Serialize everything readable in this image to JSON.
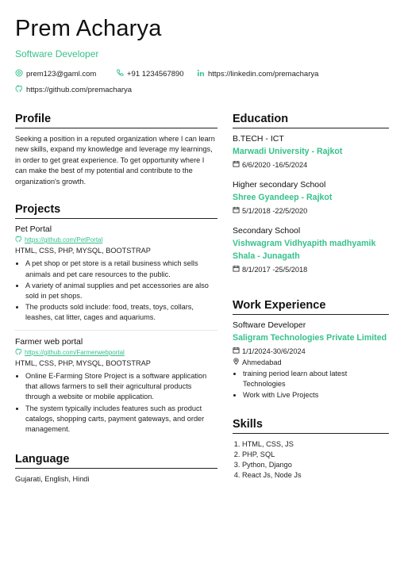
{
  "header": {
    "name": "Prem Acharya",
    "role": "Software Developer",
    "email": "prem123@gaml.com",
    "phone": "+91 1234567890",
    "linkedin": "https://linkedin.com/premacharya",
    "github": "https://github.com/premacharya"
  },
  "profile": {
    "heading": "Profile",
    "text": "Seeking a position in a reputed organization where I can learn new skills, expand my knowledge and leverage my learnings, in order to get great experience. To get opportunity where I can make the best of my potential and contribute to the organization's growth."
  },
  "projects": {
    "heading": "Projects",
    "items": [
      {
        "title": "Pet Portal",
        "link": "https://github.com/PetPortal",
        "tech": "HTML, CSS, PHP, MYSQL, BOOTSTRAP",
        "bullets": [
          "A pet shop or pet store is a retail business which sells animals and pet care resources to the public.",
          "A variety of animal supplies and pet accessories are also sold in pet shops.",
          "The products sold include: food, treats, toys, collars, leashes, cat litter, cages and aquariums."
        ]
      },
      {
        "title": "Farmer web portal",
        "link": "https://github.com/Farmerwebportal",
        "tech": "HTML, CSS, PHP, MYSQL, BOOTSTRAP",
        "bullets": [
          "Online E-Farming Store Project is a software application that allows farmers to sell their agricultural products through a website or mobile application.",
          "The system typically includes features such as product catalogs, shopping carts, payment gateways, and order management."
        ]
      }
    ]
  },
  "language": {
    "heading": "Language",
    "text": "Gujarati, English, Hindi"
  },
  "education": {
    "heading": "Education",
    "items": [
      {
        "degree": "B.TECH - ICT",
        "school": "Marwadi University - Rajkot",
        "date": "6/6/2020 -16/5/2024"
      },
      {
        "degree": "Higher secondary School",
        "school": "Shree Gyandeep - Rajkot",
        "date": "5/1/2018 -22/5/2020"
      },
      {
        "degree": "Secondary School",
        "school": "Vishwagram Vidhyapith madhyamik Shala - Junagath",
        "date": "8/1/2017 -25/5/2018"
      }
    ]
  },
  "work": {
    "heading": "Work Experience",
    "title": "Software Developer",
    "company": "Saligram Technologies Private Limited",
    "date": "1/1/2024-30/6/2024",
    "location": "Ahmedabad",
    "bullets": [
      "training period learn about latest Technologies",
      "Work with Live Projects"
    ]
  },
  "skills": {
    "heading": "Skills",
    "items": [
      "HTML, CSS, JS",
      "PHP, SQL",
      "Python, Django",
      "React Js, Node Js"
    ]
  },
  "colors": {
    "accent": "#36c18b",
    "text": "#1f1f1f"
  }
}
